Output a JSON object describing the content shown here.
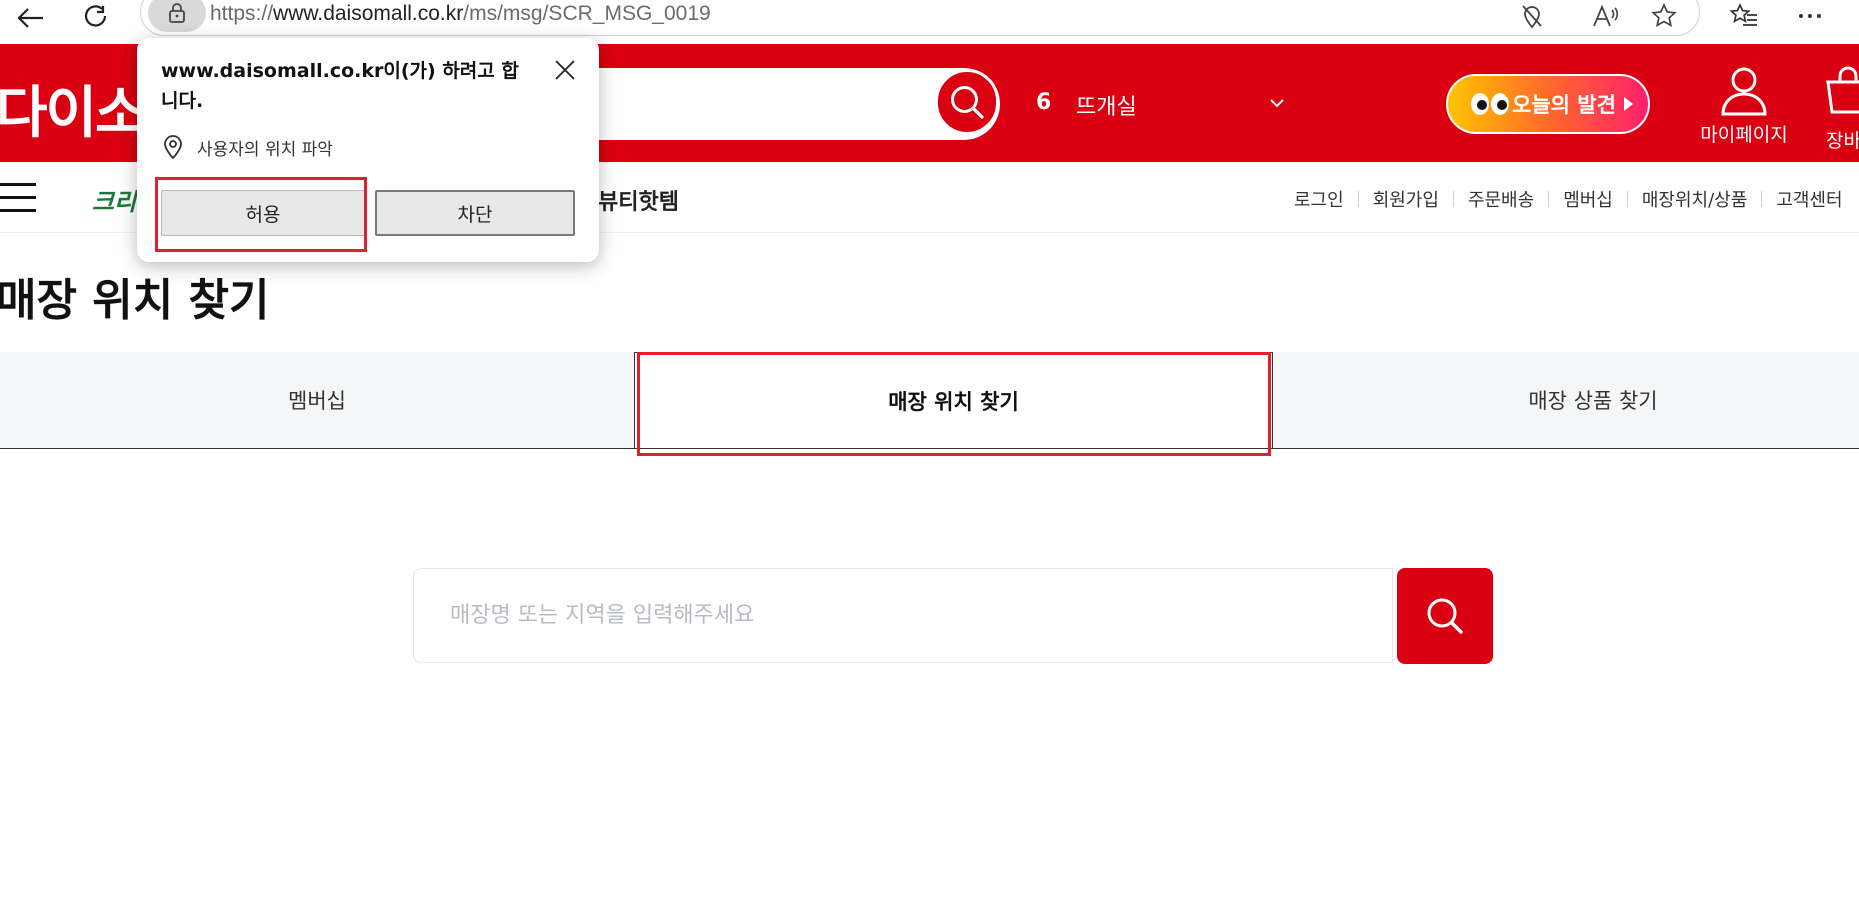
{
  "browser": {
    "url_scheme": "https://",
    "url_host": "www.daisomall.co.kr",
    "url_path": "/ms/msg/SCR_MSG_0019"
  },
  "header": {
    "logo_text": "다이소",
    "rank_number": "6",
    "rank_keyword": "뜨개실",
    "discover_label": "오늘의 발견",
    "mypage_label": "마이페이지",
    "cart_label": "장바구니"
  },
  "nav": {
    "category_cut": "크리",
    "beauty_label": "뷰티핫템",
    "util_links": [
      "로그인",
      "회원가입",
      "주문배송",
      "멤버십",
      "매장위치/상품",
      "고객센터"
    ]
  },
  "page": {
    "title": "매장 위치 찾기"
  },
  "tabs": [
    {
      "label": "멤버십",
      "active": false
    },
    {
      "label": "매장 위치 찾기",
      "active": true
    },
    {
      "label": "매장 상품 찾기",
      "active": false
    }
  ],
  "store_search": {
    "placeholder": "매장명 또는 지역을 입력해주세요",
    "value": ""
  },
  "permission_popup": {
    "title": "www.daisomall.co.kr이(가) 하려고 합니다.",
    "request": "사용자의 위치 파악",
    "allow_label": "허용",
    "block_label": "차단"
  },
  "colors": {
    "brand_red": "#da0011",
    "highlight_red": "#e0202f"
  },
  "icons": [
    "back-icon",
    "refresh-icon",
    "lock-icon",
    "location-off-icon",
    "read-aloud-icon",
    "star-icon",
    "favorites-icon",
    "more-icon",
    "search-icon",
    "chevron-down-icon",
    "eyes-icon",
    "user-icon",
    "cart-icon",
    "hamburger-icon",
    "location-pin-icon",
    "close-icon"
  ]
}
